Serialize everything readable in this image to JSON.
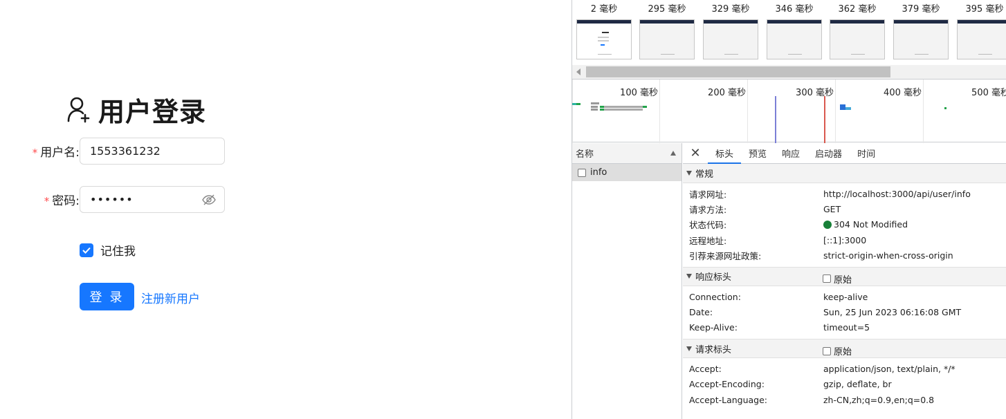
{
  "login": {
    "title": "用户登录",
    "username_label": "用户名:",
    "username_value": "1553361232",
    "password_label": "密码:",
    "password_mask": "••••••",
    "remember_label": "记住我",
    "login_button": "登 录",
    "register_link": "注册新用户",
    "colors": {
      "primary": "#1677ff",
      "required": "#ff4d4f"
    }
  },
  "devtools": {
    "filmstrip": [
      "2 毫秒",
      "295 毫秒",
      "329 毫秒",
      "346 毫秒",
      "362 毫秒",
      "379 毫秒",
      "395 毫秒"
    ],
    "overview_ticks": [
      "100 毫秒",
      "200 毫秒",
      "300 毫秒",
      "400 毫秒",
      "500 毫秒"
    ],
    "name_header": "名称",
    "requests": [
      {
        "name": "info"
      }
    ],
    "tabs": [
      "标头",
      "预览",
      "响应",
      "启动器",
      "时间"
    ],
    "active_tab": "标头",
    "general": {
      "title": "常规",
      "rows": [
        {
          "k": "请求网址:",
          "v": "http://localhost:3000/api/user/info"
        },
        {
          "k": "请求方法:",
          "v": "GET"
        },
        {
          "k": "状态代码:",
          "v": "304 Not Modified"
        },
        {
          "k": "远程地址:",
          "v": "[::1]:3000"
        },
        {
          "k": "引荐来源网址政策:",
          "v": "strict-origin-when-cross-origin"
        }
      ]
    },
    "response_headers": {
      "title": "响应标头",
      "raw_label": "原始",
      "rows": [
        {
          "k": "Connection:",
          "v": "keep-alive"
        },
        {
          "k": "Date:",
          "v": "Sun, 25 Jun 2023 06:16:08 GMT"
        },
        {
          "k": "Keep-Alive:",
          "v": "timeout=5"
        }
      ]
    },
    "request_headers": {
      "title": "请求标头",
      "raw_label": "原始",
      "rows": [
        {
          "k": "Accept:",
          "v": "application/json, text/plain, */*"
        },
        {
          "k": "Accept-Encoding:",
          "v": "gzip, deflate, br"
        },
        {
          "k": "Accept-Language:",
          "v": "zh-CN,zh;q=0.9,en;q=0.8"
        }
      ]
    },
    "colors": {
      "status_ok": "#188038",
      "tab_active": "#1a73e8"
    }
  }
}
